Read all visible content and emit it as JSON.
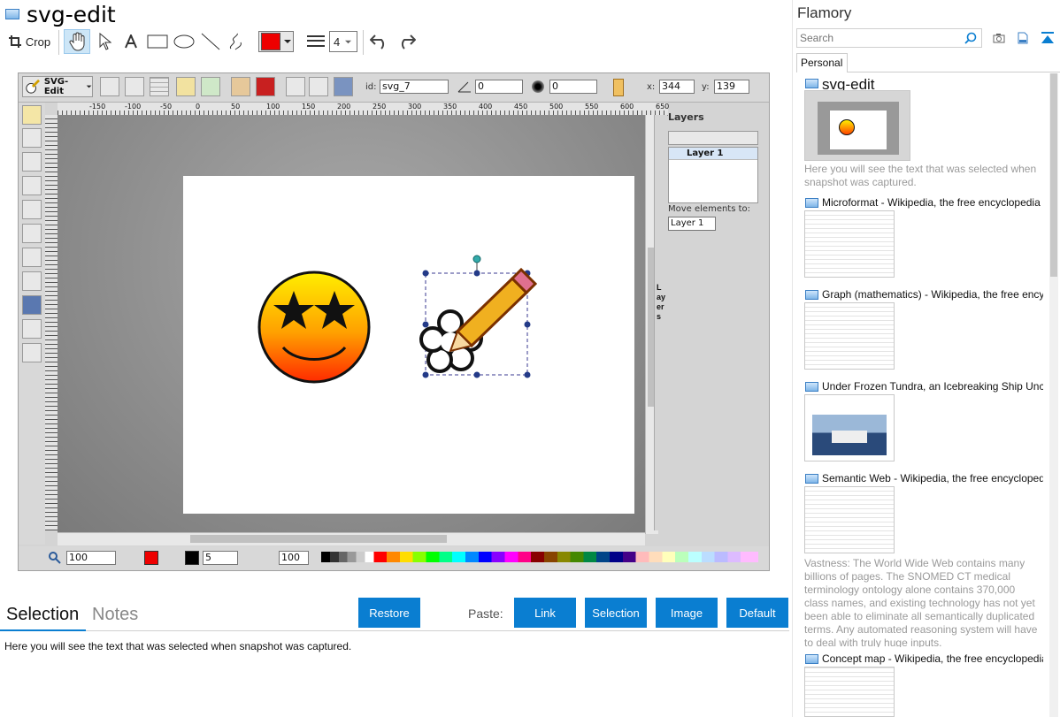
{
  "app": {
    "title": "svg-edit"
  },
  "toolbar": {
    "crop_label": "Crop",
    "stroke_width_value": "4"
  },
  "editor": {
    "logo_label": "SVG-Edit",
    "id_label": "id:",
    "id_value": "svg_7",
    "angle_value": "0",
    "blur_value": "0",
    "x_label": "x:",
    "x_value": "344",
    "y_label": "y:",
    "y_value": "139",
    "ruler_ticks": [
      "-150",
      "-100",
      "-50",
      "0",
      "50",
      "100",
      "150",
      "200",
      "250",
      "300",
      "350",
      "400",
      "450",
      "500",
      "550",
      "600",
      "650"
    ],
    "layers_title": "Layers",
    "layer_name": "Layer 1",
    "move_to_label": "Move elements to:",
    "move_to_value": "Layer 1",
    "layers_tab": "Layers",
    "zoom_value": "100",
    "stroke_value": "5",
    "opacity_value": "100"
  },
  "bottom": {
    "tab_selection": "Selection",
    "tab_notes": "Notes",
    "restore_label": "Restore",
    "paste_label": "Paste:",
    "link_label": "Link",
    "selection_label": "Selection",
    "image_label": "Image",
    "default_label": "Default",
    "selection_text": "Here you will see the text that was selected when snapshot was captured."
  },
  "sidebar": {
    "app_name": "Flamory",
    "search_placeholder": "Search",
    "tab_personal": "Personal",
    "snapshots": [
      {
        "title": "svg-edit",
        "desc": "Here you will see the text that was selected when snapshot was captured."
      },
      {
        "title": "Microformat - Wikipedia, the free encyclopedia",
        "desc": ""
      },
      {
        "title": "Graph (mathematics) - Wikipedia, the free encyclopedia",
        "desc": ""
      },
      {
        "title": "Under Frozen Tundra, an Icebreaking Ship Uncovers",
        "desc": ""
      },
      {
        "title": "Semantic Web - Wikipedia, the free encyclopedia",
        "desc": "Vastness: The World Wide Web contains many billions of pages. The SNOMED CT medical terminology ontology alone contains 370,000 class names, and existing technology has not yet been able to eliminate all semantically duplicated terms. Any automated reasoning system will have to deal with truly huge inputs."
      },
      {
        "title": "Concept map - Wikipedia, the free encyclopedia",
        "desc": ""
      }
    ]
  },
  "colors": {
    "accent": "#0a7ed1",
    "fill_color": "#ee0000",
    "editor_bg": "#d4d4d4",
    "canvas_bg": "#8a8a8a"
  }
}
